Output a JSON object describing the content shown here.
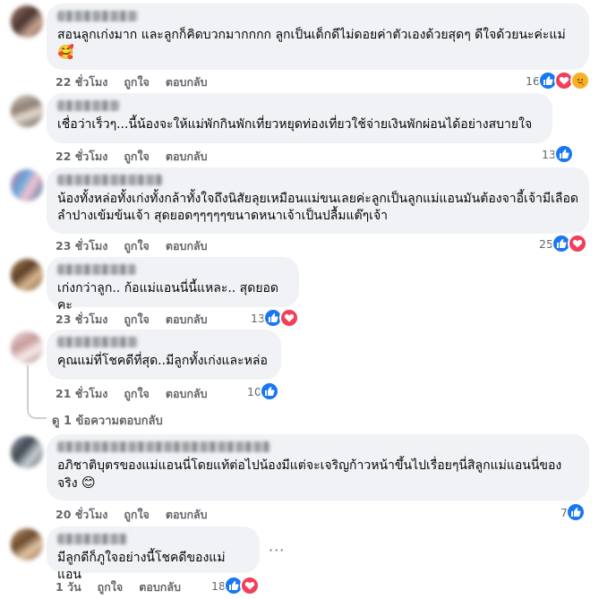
{
  "actions": {
    "like": "ถูกใจ",
    "reply": "ตอบกลับ"
  },
  "comments": [
    {
      "text": "สอนลูกเก่งมาก และลูกก็คิดบวกมากกกก ลูกเป็นเด็กดีไม่ดอยค่าตัวเองด้วยสุดๆ ดีใจด้วยนะค่ะแม่",
      "emoji": "🥰",
      "time": "22 ชั่วโมง",
      "count": "16",
      "reactions": [
        "like-icon",
        "love-icon",
        "care-icon"
      ]
    },
    {
      "text": "เชื่อว่าเร็วๆ...นี้น้องจะให้แม่พักกินพักเที่ยวหยุดท่องเที่ยวใช้จ่ายเงินพักผ่อนได้อย่างสบายใจ",
      "time": "22 ชั่วโมง",
      "count": "13",
      "reactions": [
        "like-icon"
      ]
    },
    {
      "text": "น้องทั้งหล่อทั้งเก่งทั้งกล้าทั้งใจถึงนิสัยลุยเหมือนแม่ขนเลยค่ะลูกเป็นลูกแม่แอนมันต้องจาอี้เจ้ามีเลือดลำปางเข้มข้นเจ้า สุดยอดๆๆๆๆๆขนาดหนาเจ้าเป็นปลื้มแต๊ๆเจ้า",
      "time": "23 ชั่วโมง",
      "count": "25",
      "reactions": [
        "like-icon",
        "love-icon"
      ]
    },
    {
      "text": "เก่งกว่าลูก.. ก้อแม่แอนนี่นี้แหละ.. สุดยอดคะ",
      "time": "23 ชั่วโมง",
      "count": "13",
      "reactions": [
        "like-icon",
        "love-icon"
      ]
    },
    {
      "text": "คุณแม่ที่โชคดีที่สุด..มีลูกทั้งเก่งและหล่อ",
      "time": "21 ชั่วโมง",
      "count": "10",
      "reactions": [
        "like-icon"
      ],
      "replies": "ดู 1 ข้อความตอบกลับ"
    },
    {
      "text": "อภิชาติบุตรของแม่แอนนี่โดยแท้ต่อไปน้องมีแต่จะเจริญก้าวหน้าขึ้นไปเรื่อยๆนี่สิลูกแม่แอนนี่ของจริง",
      "emoji": "😊",
      "time": "20 ชั่วโมง",
      "count": "7",
      "reactions": [
        "like-icon"
      ]
    },
    {
      "text": "มีลูกดีก็ภูใจอย่างนี้โชคดีของแม่แอน",
      "time": "1 วัน",
      "count": "18",
      "reactions": [
        "like-icon",
        "love-icon"
      ],
      "more": "···"
    }
  ]
}
